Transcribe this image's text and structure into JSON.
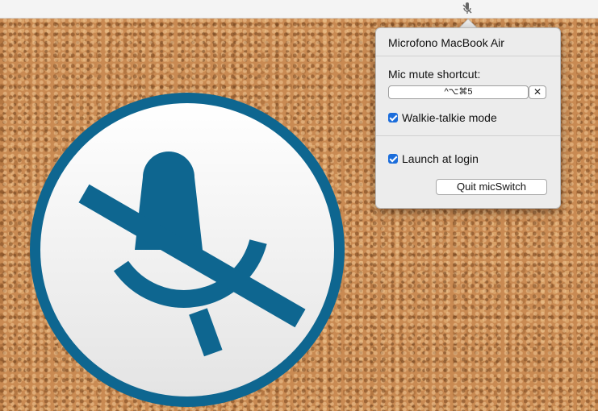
{
  "menubar": {
    "status_icon": "mic-muted-icon"
  },
  "popover": {
    "device_name": "Microfono MacBook Air",
    "shortcut_label": "Mic mute shortcut:",
    "shortcut_value": "^⌥⌘5",
    "clear_label": "✕",
    "walkie_talkie": {
      "label": "Walkie-talkie mode",
      "checked": true
    },
    "launch_at_login": {
      "label": "Launch at login",
      "checked": true
    },
    "quit_label": "Quit micSwitch"
  },
  "app_icon": {
    "name": "mic-muted-app-icon",
    "color": "#0e6690",
    "background": "#f0f0f0"
  },
  "colors": {
    "accent": "#1b6ddb",
    "brand": "#0e6690"
  }
}
